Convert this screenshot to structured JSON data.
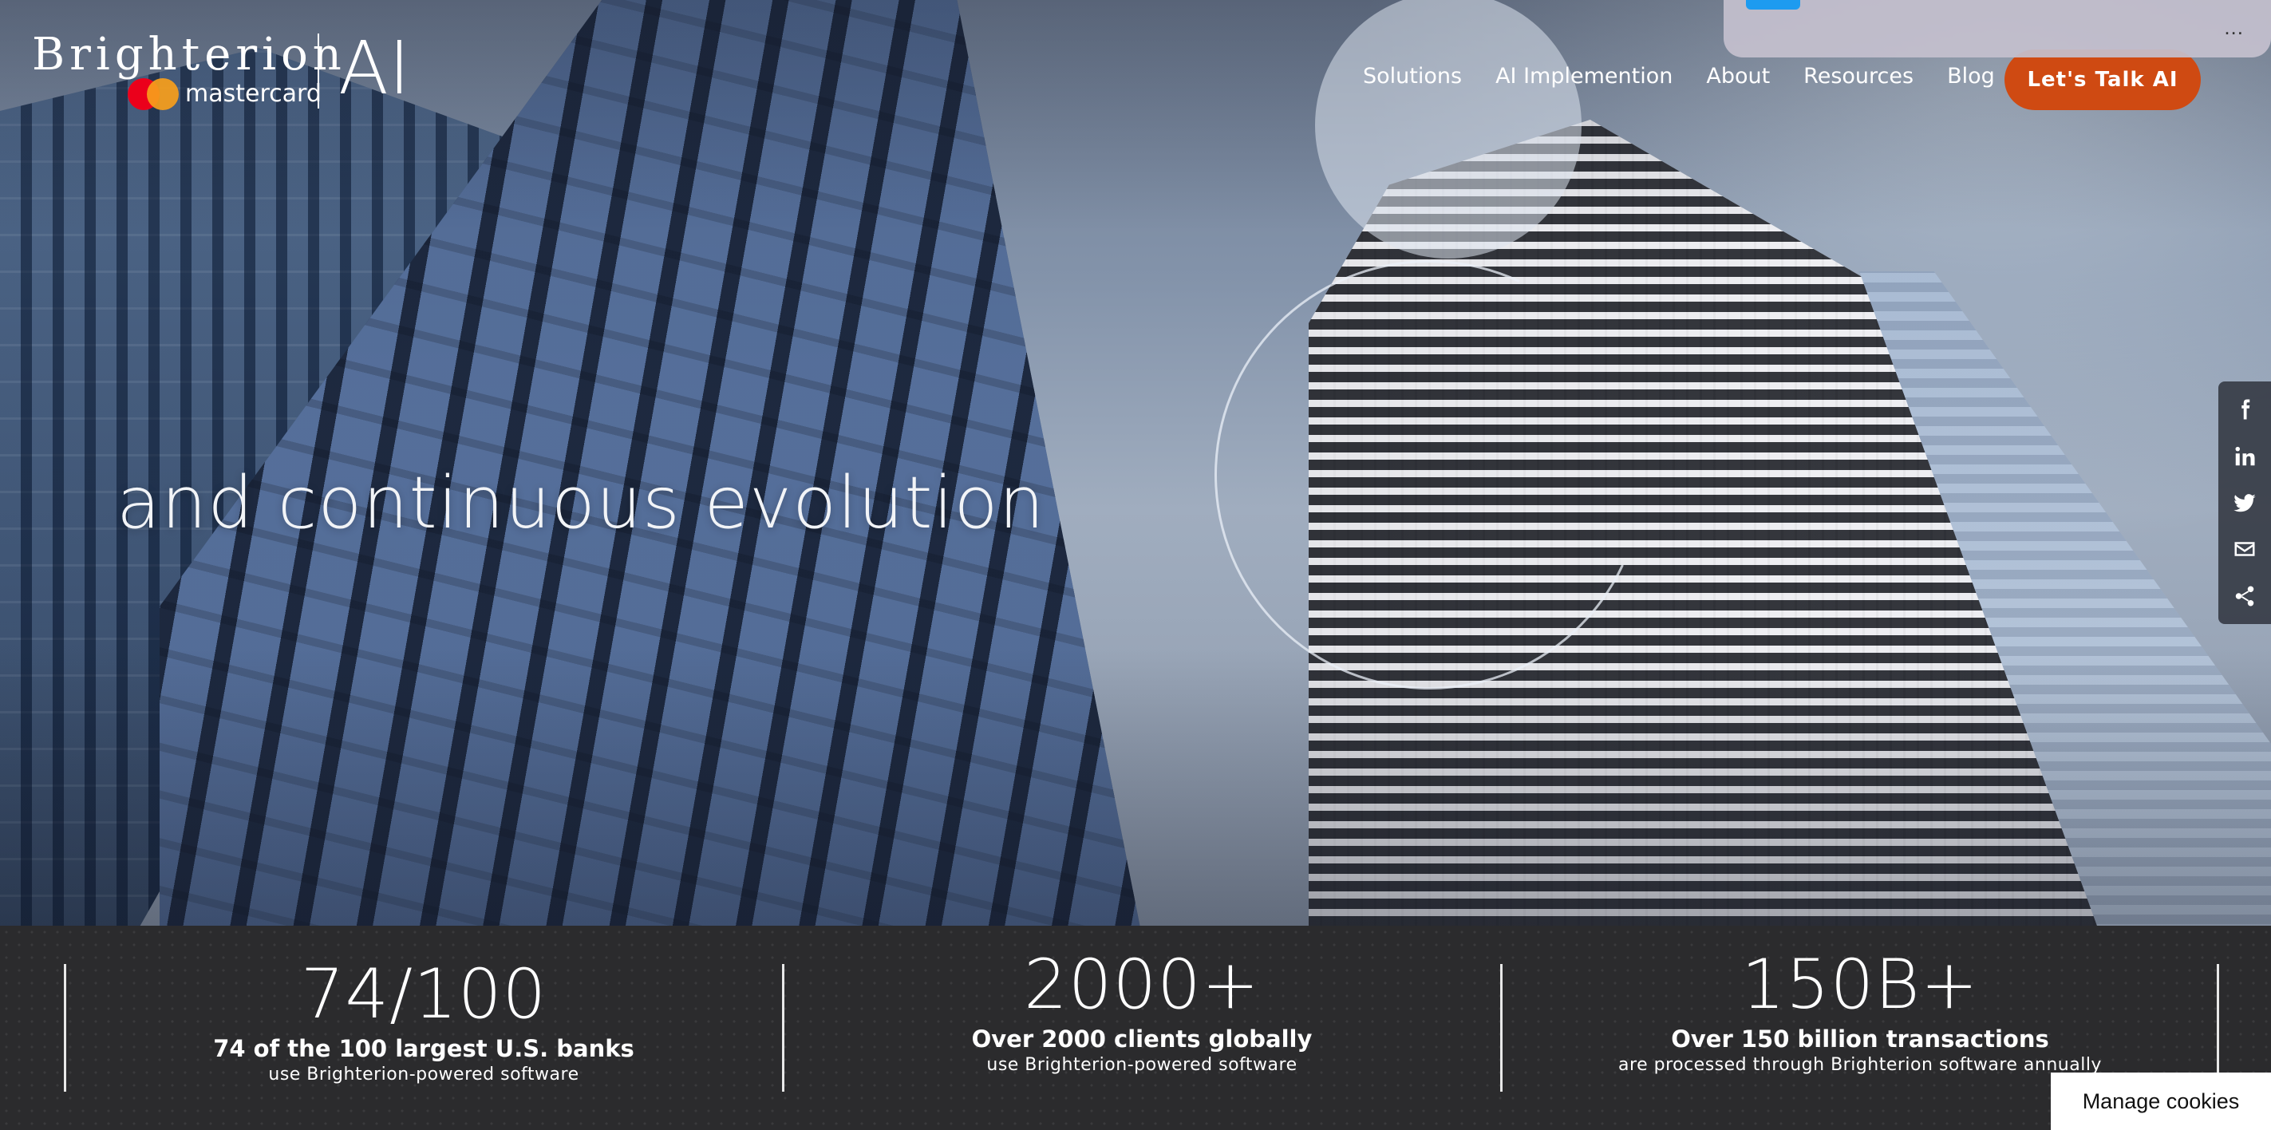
{
  "logo": {
    "brand": "Brighterion",
    "partner": "mastercard",
    "suffix": "AI"
  },
  "nav": {
    "items": [
      "Solutions",
      "AI Implemention",
      "About",
      "Resources",
      "Blog"
    ],
    "cta_label": "Let's Talk AI"
  },
  "hero": {
    "headline": "and continuous evolution"
  },
  "popup": {
    "more": "..."
  },
  "share": {
    "icons": [
      "facebook-icon",
      "linkedin-icon",
      "twitter-icon",
      "email-icon",
      "share-icon"
    ]
  },
  "stats": [
    {
      "number": "74/100",
      "title": "74 of the 100 largest U.S. banks",
      "sub": "use Brighterion-powered software"
    },
    {
      "number": "2000+",
      "title": "Over 2000 clients globally",
      "sub": "use Brighterion-powered software"
    },
    {
      "number": "150B+",
      "title": "Over 150 billion transactions",
      "sub": "are processed through Brighterion software annually"
    }
  ],
  "cookies": {
    "label": "Manage cookies"
  },
  "colors": {
    "accent": "#cf4a12",
    "stats_bg": "#2b2b2d",
    "mc_red": "#eb001b",
    "mc_yellow": "#f79e1b"
  }
}
